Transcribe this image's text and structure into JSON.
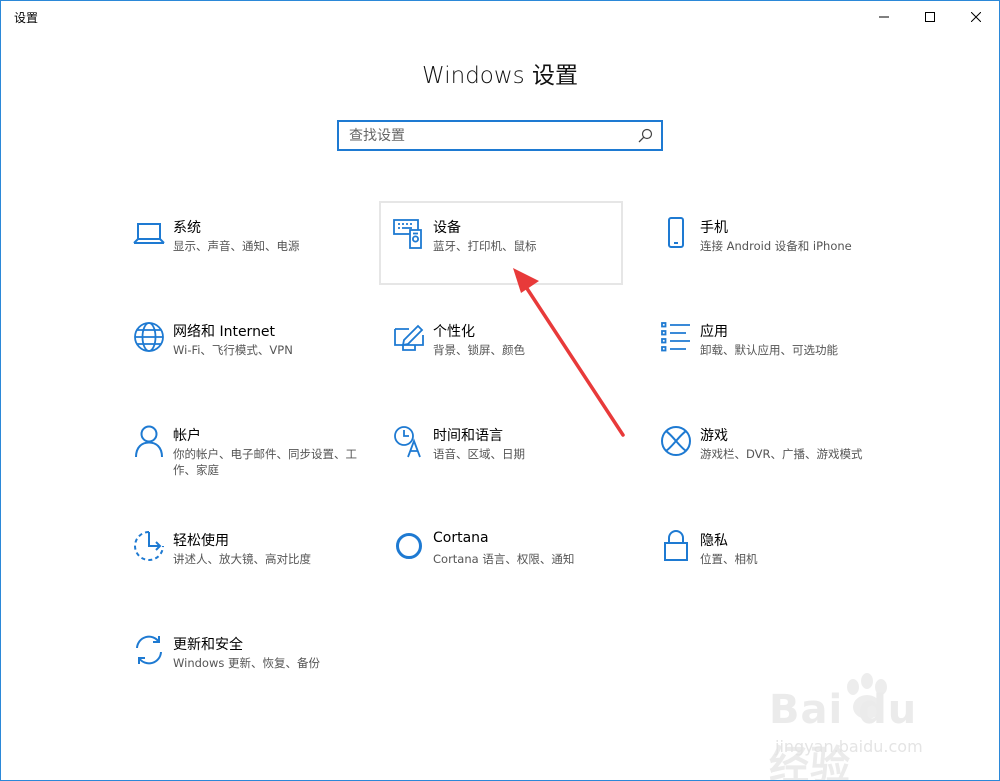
{
  "window": {
    "title": "设置"
  },
  "header": {
    "title": "Windows 设置"
  },
  "search": {
    "placeholder": "查找设置"
  },
  "tiles": [
    {
      "title": "系统",
      "sub": "显示、声音、通知、电源",
      "icon": "laptop-icon"
    },
    {
      "title": "设备",
      "sub": "蓝牙、打印机、鼠标",
      "icon": "devices-icon"
    },
    {
      "title": "手机",
      "sub": "连接 Android 设备和 iPhone",
      "icon": "phone-icon"
    },
    {
      "title": "网络和 Internet",
      "sub": "Wi-Fi、飞行模式、VPN",
      "icon": "globe-icon"
    },
    {
      "title": "个性化",
      "sub": "背景、锁屏、颜色",
      "icon": "personalization-icon"
    },
    {
      "title": "应用",
      "sub": "卸载、默认应用、可选功能",
      "icon": "apps-list-icon"
    },
    {
      "title": "帐户",
      "sub": "你的帐户、电子邮件、同步设置、工作、家庭",
      "icon": "person-icon"
    },
    {
      "title": "时间和语言",
      "sub": "语音、区域、日期",
      "icon": "time-language-icon"
    },
    {
      "title": "游戏",
      "sub": "游戏栏、DVR、广播、游戏模式",
      "icon": "xbox-icon"
    },
    {
      "title": "轻松使用",
      "sub": "讲述人、放大镜、高对比度",
      "icon": "ease-of-access-icon"
    },
    {
      "title": "Cortana",
      "sub": "Cortana 语言、权限、通知",
      "icon": "cortana-icon"
    },
    {
      "title": "隐私",
      "sub": "位置、相机",
      "icon": "lock-icon"
    },
    {
      "title": "更新和安全",
      "sub": "Windows 更新、恢复、备份",
      "icon": "update-sync-icon"
    }
  ],
  "colors": {
    "accent": "#1e7ad2",
    "annotation": "#e83a3a"
  }
}
